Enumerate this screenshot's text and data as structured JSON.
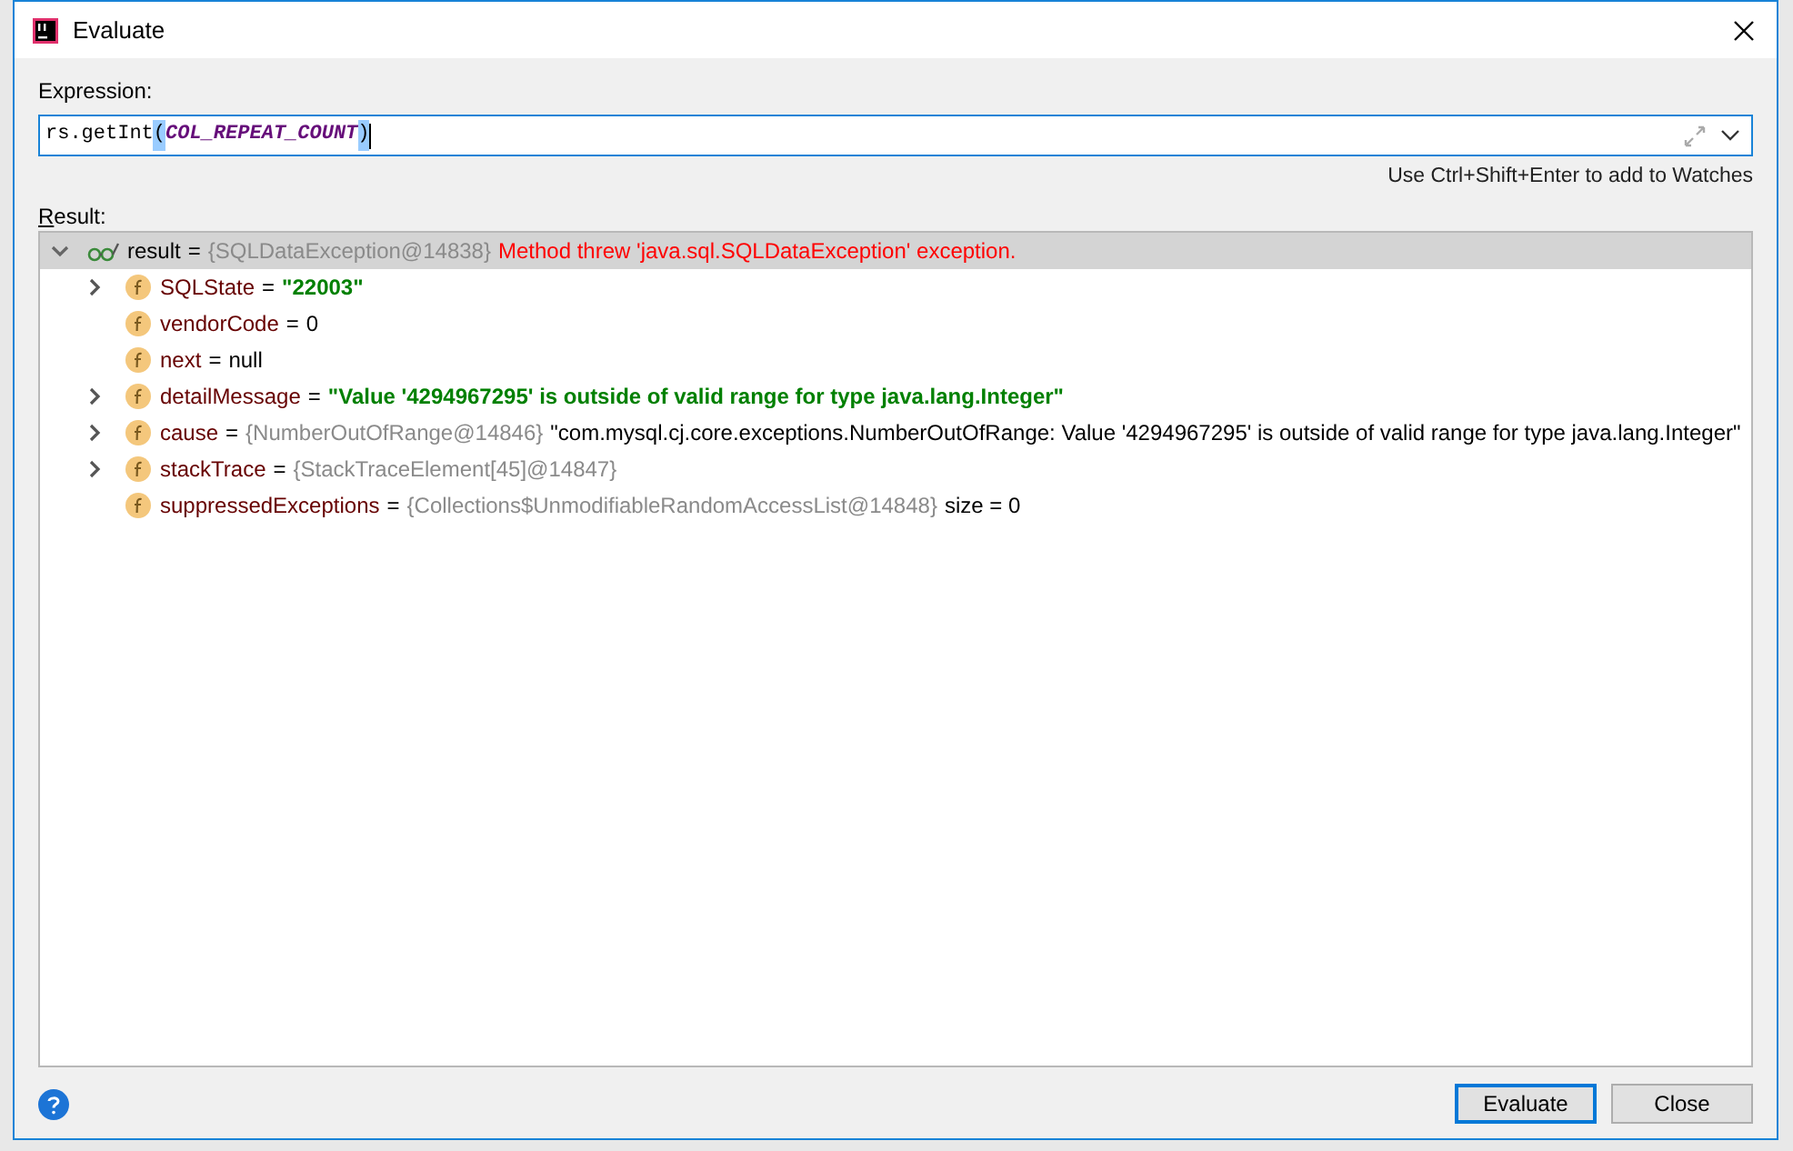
{
  "window": {
    "title": "Evaluate"
  },
  "expression": {
    "label": "Expression:",
    "parts": [
      {
        "kind": "plain",
        "text": "rs.getInt"
      },
      {
        "kind": "brace_match",
        "text": "("
      },
      {
        "kind": "constant",
        "text": "COL_REPEAT_COUNT"
      },
      {
        "kind": "brace_match",
        "text": ")"
      }
    ]
  },
  "hint": "Use Ctrl+Shift+Enter to add to Watches",
  "result_label": "Result:",
  "result": {
    "name": "result",
    "separator": "=",
    "expanded": true,
    "selected": true,
    "value": [
      {
        "kind": "ref",
        "text": "{SQLDataException@14838}"
      },
      {
        "kind": "error",
        "text": "Method threw 'java.sql.SQLDataException' exception."
      }
    ],
    "children": [
      {
        "name": "SQLState",
        "separator": "=",
        "expandable": true,
        "value": [
          {
            "kind": "string",
            "text": "\"22003\""
          }
        ]
      },
      {
        "name": "vendorCode",
        "separator": "=",
        "expandable": false,
        "value": [
          {
            "kind": "plain",
            "text": "0"
          }
        ]
      },
      {
        "name": "next",
        "separator": "=",
        "expandable": false,
        "value": [
          {
            "kind": "plain",
            "text": "null"
          }
        ]
      },
      {
        "name": "detailMessage",
        "separator": "=",
        "expandable": true,
        "value": [
          {
            "kind": "string",
            "text": "\"Value '4294967295' is outside of valid range for type java.lang.Integer\""
          }
        ]
      },
      {
        "name": "cause",
        "separator": "=",
        "expandable": true,
        "value": [
          {
            "kind": "ref",
            "text": "{NumberOutOfRange@14846}"
          },
          {
            "kind": "plain",
            "text": "\"com.mysql.cj.core.exceptions.NumberOutOfRange: Value '4294967295' is outside of valid range for type java.lang.Integer\""
          }
        ]
      },
      {
        "name": "stackTrace",
        "separator": "=",
        "expandable": true,
        "value": [
          {
            "kind": "ref",
            "text": "{StackTraceElement[45]@14847}"
          }
        ]
      },
      {
        "name": "suppressedExceptions",
        "separator": "=",
        "expandable": false,
        "value": [
          {
            "kind": "ref",
            "text": "{Collections$UnmodifiableRandomAccessList@14848}"
          },
          {
            "kind": "plain",
            "text": "size = 0"
          }
        ]
      }
    ]
  },
  "buttons": [
    {
      "label": "Evaluate",
      "default": true
    },
    {
      "label": "Close",
      "default": false
    }
  ]
}
